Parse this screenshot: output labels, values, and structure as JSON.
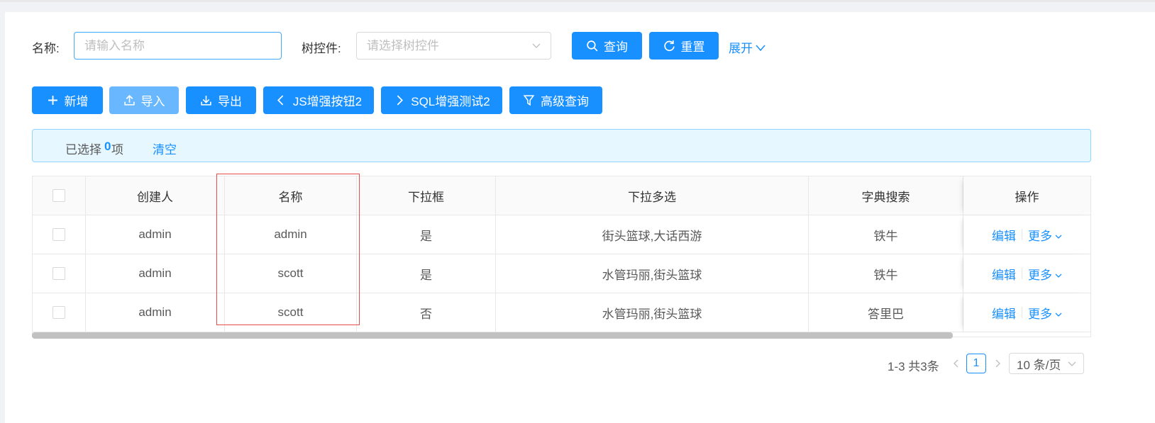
{
  "search": {
    "name_label": "名称:",
    "name_placeholder": "请输入名称",
    "tree_label": "树控件:",
    "tree_placeholder": "请选择树控件",
    "query_label": "查询",
    "reset_label": "重置",
    "expand_label": "展开"
  },
  "toolbar": {
    "add_label": "新增",
    "import_label": "导入",
    "export_label": "导出",
    "js_label": "JS增强按钮2",
    "sql_label": "SQL增强测试2",
    "advanced_label": "高级查询"
  },
  "alert": {
    "prefix": "已选择",
    "count": "0",
    "suffix": "项",
    "clear_label": "清空"
  },
  "table": {
    "columns": [
      "创建人",
      "名称",
      "下拉框",
      "下拉多选",
      "字典搜索",
      "操作"
    ],
    "rows": [
      {
        "creator": "admin",
        "name": "admin",
        "select": "是",
        "multi": "街头篮球,大话西游",
        "dict": "铁牛"
      },
      {
        "creator": "admin",
        "name": "scott",
        "select": "是",
        "multi": "水管玛丽,街头篮球",
        "dict": "铁牛"
      },
      {
        "creator": "admin",
        "name": "scott",
        "select": "否",
        "multi": "水管玛丽,街头篮球",
        "dict": "答里巴"
      }
    ],
    "edit_label": "编辑",
    "more_label": "更多"
  },
  "pagination": {
    "total": "1-3 共3条",
    "current": "1",
    "page_size": "10 条/页"
  },
  "colors": {
    "primary": "#1890ff",
    "highlight": "#e84c4c"
  }
}
